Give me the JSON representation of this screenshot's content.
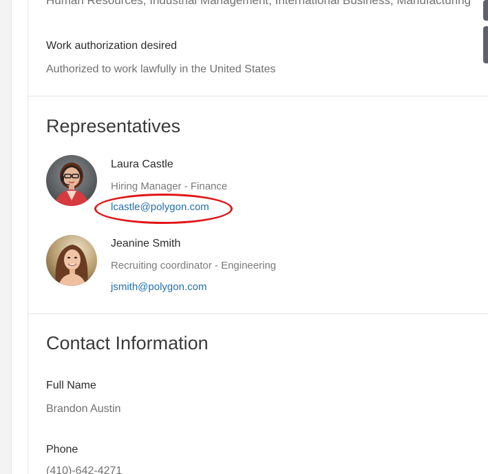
{
  "profile": {
    "interests_cutoff": "Human Resources, Industrial Management, International Business, Manufacturing",
    "work_auth_label": "Work authorization desired",
    "work_auth_value": "Authorized to work lawfully in the United States"
  },
  "representatives": {
    "title": "Representatives",
    "people": [
      {
        "name": "Laura Castle",
        "role": "Hiring Manager - Finance",
        "email": "lcastle@polygon.com"
      },
      {
        "name": "Jeanine Smith",
        "role": "Recruiting coordinator - Engineering",
        "email": "jsmith@polygon.com"
      }
    ]
  },
  "contact": {
    "title": "Contact Information",
    "full_name_label": "Full Name",
    "full_name_value": "Brandon Austin",
    "phone_label": "Phone",
    "phone_value": "(410)-642-4271"
  },
  "colors": {
    "link": "#1f6fae",
    "highlight": "#e01616",
    "label": "#2a2a2a",
    "muted": "#707070"
  },
  "icons": {
    "avatar_1": "avatar-laura-castle",
    "avatar_2": "avatar-jeanine-smith"
  }
}
